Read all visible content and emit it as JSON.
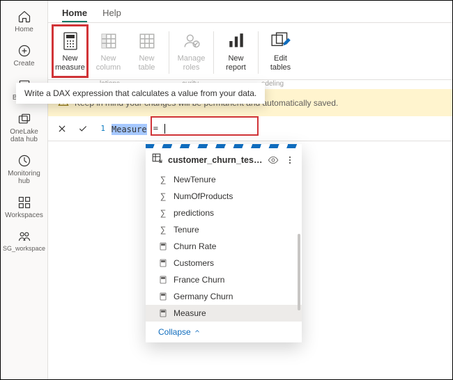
{
  "sidebar": {
    "items": [
      {
        "label": "Home"
      },
      {
        "label": "Create"
      },
      {
        "label": "Browse"
      },
      {
        "label": "OneLake\ndata hub"
      },
      {
        "label": "Monitoring\nhub"
      },
      {
        "label": "Workspaces"
      },
      {
        "label": "SG_workspace"
      }
    ]
  },
  "tabs": {
    "home": "Home",
    "help": "Help"
  },
  "ribbon": {
    "new_measure": "New\nmeasure",
    "new_column": "New\ncolumn",
    "new_table": "New\ntable",
    "manage_roles": "Manage\nroles",
    "new_report": "New\nreport",
    "edit_tables": "Edit\ntables",
    "group_calc": "lations",
    "group_sec": "curity",
    "group_model": "odeling"
  },
  "tooltip": "Write a DAX expression that calculates a value from your data.",
  "warning": "Keep in mind your changes will be permanent and automatically saved.",
  "formula": {
    "line": "1",
    "sel": "Measure",
    "rest": " = "
  },
  "card": {
    "title": "customer_churn_test_...",
    "fields": [
      {
        "icon": "sum",
        "label": "NewTenure"
      },
      {
        "icon": "sum",
        "label": "NumOfProducts"
      },
      {
        "icon": "sum",
        "label": "predictions"
      },
      {
        "icon": "sum",
        "label": "Tenure"
      },
      {
        "icon": "calc",
        "label": "Churn Rate"
      },
      {
        "icon": "calc",
        "label": "Customers"
      },
      {
        "icon": "calc",
        "label": "France Churn"
      },
      {
        "icon": "calc",
        "label": "Germany Churn"
      },
      {
        "icon": "calc",
        "label": "Measure",
        "selected": true
      }
    ],
    "collapse": "Collapse"
  }
}
